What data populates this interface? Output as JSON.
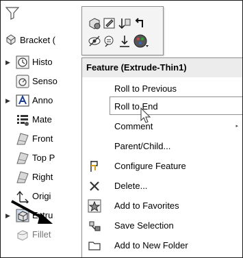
{
  "tree": {
    "root_label": "Bracket (",
    "rows": [
      {
        "label": "Histo",
        "expander": true,
        "icon": "history-icon"
      },
      {
        "label": "Senso",
        "expander": false,
        "icon": "sensors-icon"
      },
      {
        "label": "Anno",
        "expander": true,
        "icon": "annotations-icon"
      },
      {
        "label": "Mate",
        "expander": false,
        "icon": "material-icon"
      },
      {
        "label": "Front",
        "expander": false,
        "icon": "plane-icon"
      },
      {
        "label": "Top P",
        "expander": false,
        "icon": "plane-icon"
      },
      {
        "label": "Right",
        "expander": false,
        "icon": "plane-icon"
      },
      {
        "label": "Origi",
        "expander": false,
        "icon": "origin-icon"
      },
      {
        "label": "Extru",
        "expander": true,
        "icon": "extrude-icon"
      },
      {
        "label": "Fillet",
        "expander": false,
        "icon": "fillet-icon"
      }
    ]
  },
  "toolbar": {
    "buttons": [
      "edit-feature-icon",
      "edit-sketch-icon",
      "rollback-icon",
      "parent-icon",
      "hide-icon",
      "smart-dimension-icon",
      "insert-icon",
      "appearance-icon"
    ]
  },
  "menu": {
    "header": "Feature (Extrude-Thin1)",
    "items": [
      {
        "label": "Roll to Previous",
        "icon": ""
      },
      {
        "label": "Roll to End",
        "icon": ""
      },
      {
        "label": "Comment",
        "icon": "",
        "submenu": true
      },
      {
        "label": "Parent/Child...",
        "icon": ""
      },
      {
        "label": "Configure Feature",
        "icon": "configure-icon"
      },
      {
        "label": "Delete...",
        "icon": "delete-icon"
      },
      {
        "label": "Add to Favorites",
        "icon": "favorites-icon"
      },
      {
        "label": "Save Selection",
        "icon": "save-selection-icon"
      },
      {
        "label": "Add to New Folder",
        "icon": "folder-icon"
      }
    ]
  },
  "colors": {
    "accent": "#8e8e8e",
    "delete_x": "#333333",
    "arrow": "#000000"
  }
}
